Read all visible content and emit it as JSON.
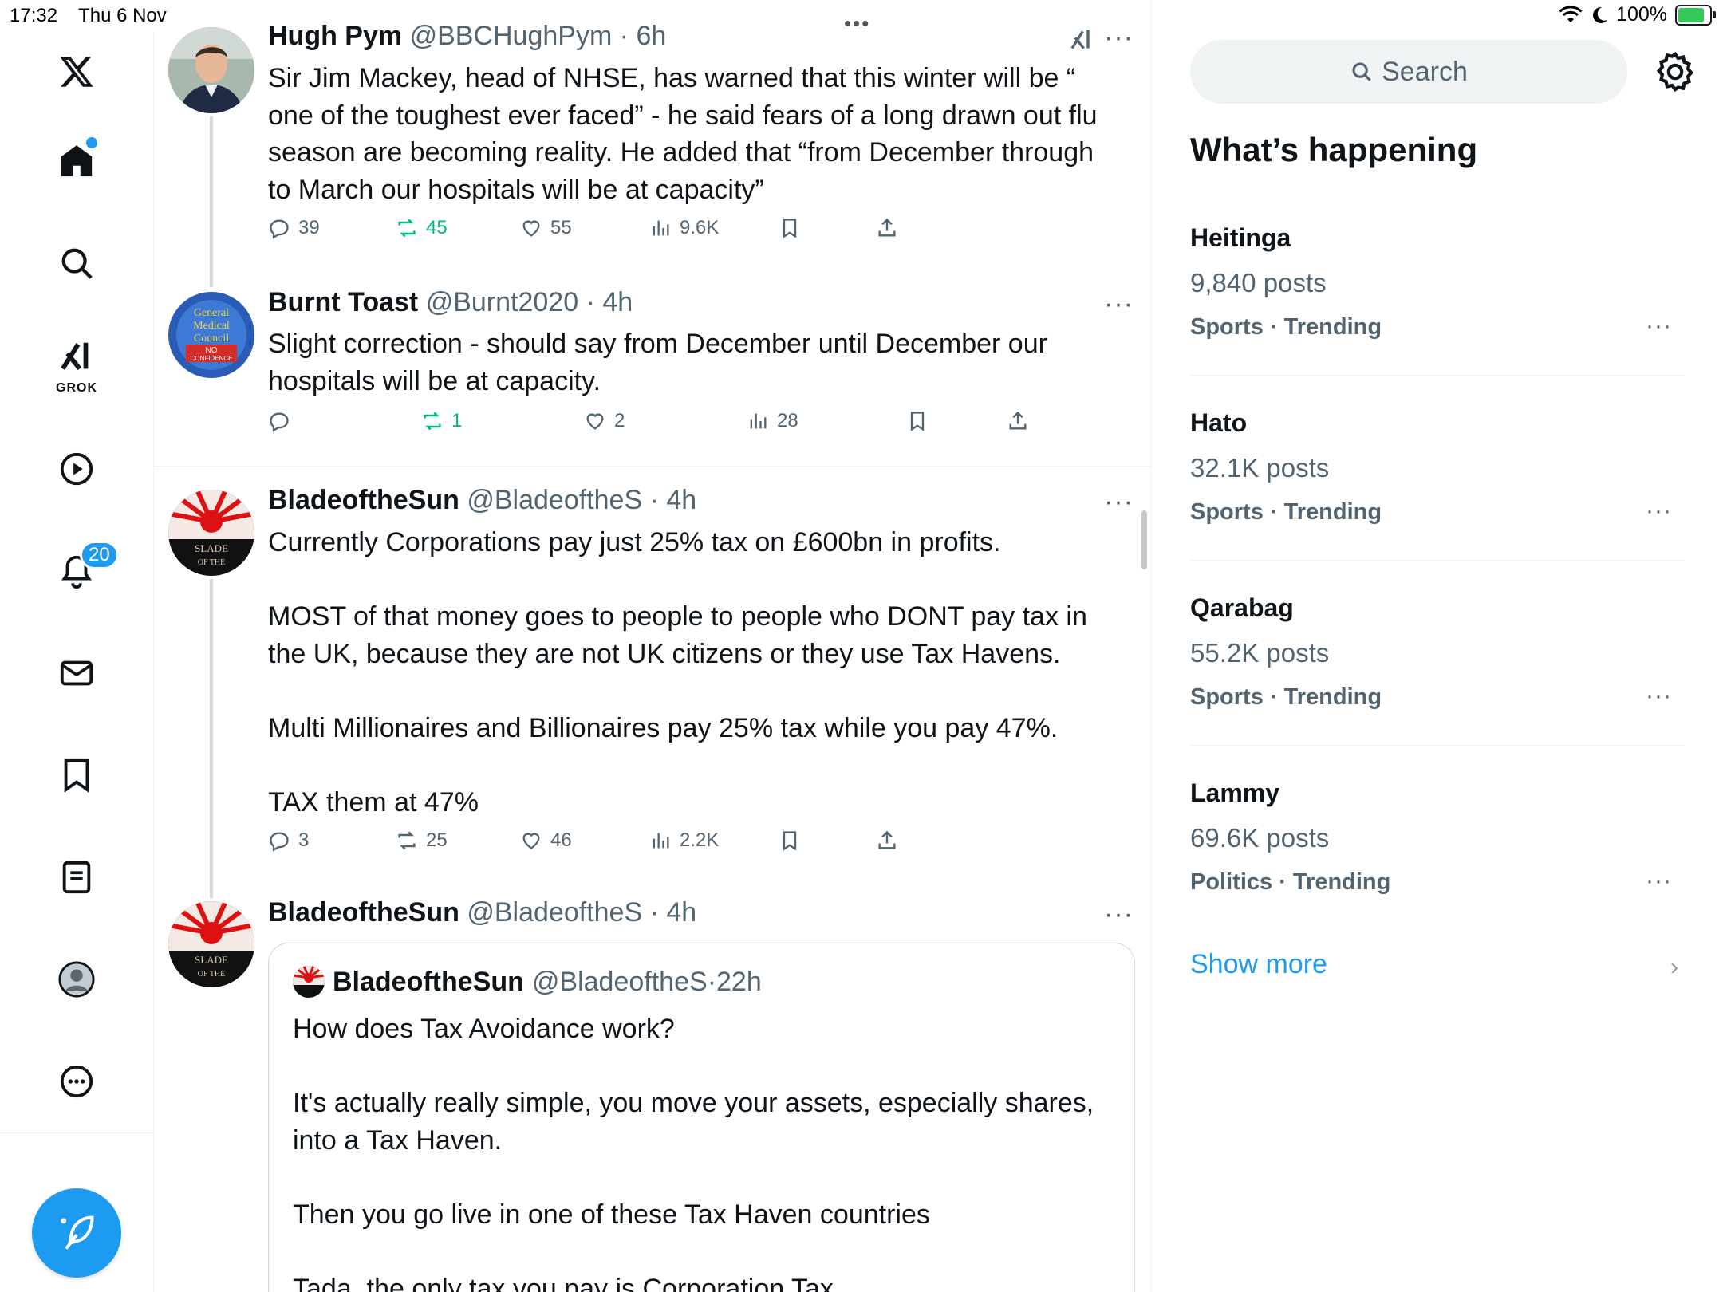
{
  "status_bar": {
    "time": "17:32",
    "date": "Thu 6 Nov",
    "battery": "100%"
  },
  "colors": {
    "accent": "#1d9bf0",
    "repost_active": "#00ba7c",
    "secondary_text": "#536471"
  },
  "nav": {
    "items": [
      "x-logo",
      "home",
      "search",
      "grok",
      "video",
      "notifications",
      "messages",
      "bookmarks",
      "lists",
      "profile",
      "more"
    ],
    "grok_label": "GROK",
    "notifications_badge": "20"
  },
  "tweets": [
    {
      "name": "Hugh Pym",
      "handle": "@BBCHughPym",
      "time": "6h",
      "text": "Sir Jim Mackey, head of NHSE, has warned that this winter will be “ one of the toughest ever faced” - he said fears of a long drawn out flu season are becoming reality. He added that “from December through to March our hospitals will be at capacity”",
      "replies": "39",
      "reposts": "45",
      "likes": "55",
      "views": "9.6K"
    },
    {
      "name": "Burnt Toast",
      "handle": "@Burnt2020",
      "time": "4h",
      "avatar_text": [
        "General",
        "Medical",
        "Council",
        "NO",
        "CONFIDENCE"
      ],
      "text": "Slight correction - should say from December until December our hospitals will be at capacity.",
      "replies": "",
      "reposts": "1",
      "likes": "2",
      "views": "28"
    },
    {
      "name": "BladeoftheSun",
      "handle": "@BladeoftheS",
      "time": "4h",
      "avatar_text": [
        "SLADE",
        "OF THE"
      ],
      "text": "Currently Corporations pay just 25% tax on £600bn in profits.\n\nMOST of that money goes to people to people who DONT pay tax in the UK, because they are not UK citizens or they use Tax Havens.\n\nMulti Millionaires and Billionaires pay 25% tax while you pay 47%.\n\nTAX them at 47%",
      "replies": "3",
      "reposts": "25",
      "likes": "46",
      "views": "2.2K"
    },
    {
      "name": "BladeoftheSun",
      "handle": "@BladeoftheS",
      "time": "4h",
      "avatar_text": [
        "SLADE",
        "OF THE"
      ],
      "quote": {
        "name": "BladeoftheSun",
        "handle": "@BladeoftheS",
        "time": "22h",
        "text": "How does Tax Avoidance work?\n\nIt's actually really simple, you move your assets, especially shares, into a Tax Haven.\n\nThen you go live in one of these Tax Haven countries\n\nTada, the only tax you pay is Corporation Tax"
      }
    }
  ],
  "right": {
    "search_placeholder": "Search",
    "title": "What’s happening",
    "trends": [
      {
        "name": "Heitinga",
        "count": "9,840 posts",
        "category": "Sports · Trending"
      },
      {
        "name": "Hato",
        "count": "32.1K posts",
        "category": "Sports · Trending"
      },
      {
        "name": "Qarabag",
        "count": "55.2K posts",
        "category": "Sports · Trending"
      },
      {
        "name": "Lammy",
        "count": "69.6K posts",
        "category": "Politics · Trending"
      }
    ],
    "show_more": "Show more"
  }
}
